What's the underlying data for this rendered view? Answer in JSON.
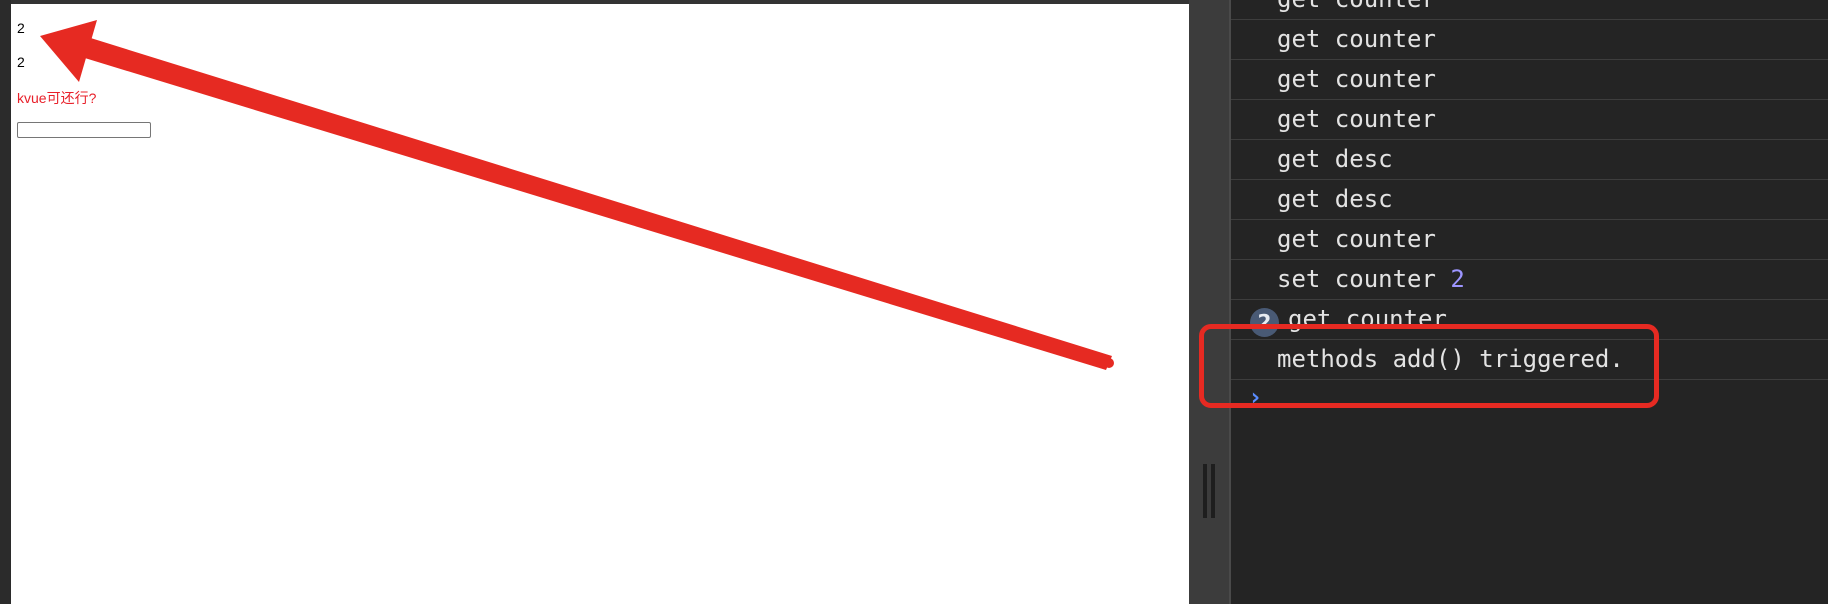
{
  "app": {
    "counter_line_1": "2",
    "counter_line_2": "2",
    "description": "kvue可还行?",
    "input_value": ""
  },
  "console": {
    "rows": [
      {
        "text": "get counter"
      },
      {
        "text": "get counter"
      },
      {
        "text": "get counter"
      },
      {
        "text": "get counter"
      },
      {
        "text": "get desc"
      },
      {
        "text": "get desc"
      },
      {
        "text": "get counter"
      },
      {
        "text": "set counter ",
        "value": "2"
      },
      {
        "text": "get counter",
        "repeat_count": "2"
      },
      {
        "text": "methods add() triggered."
      }
    ],
    "prompt_symbol": "›"
  },
  "colors": {
    "annotation_red": "#e62a22",
    "console_number": "#9d95ff",
    "description_text": "#e8202a"
  }
}
